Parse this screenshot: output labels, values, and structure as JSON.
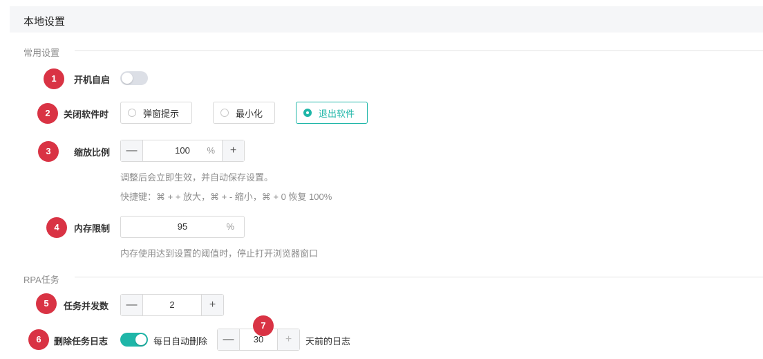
{
  "header": {
    "title": "本地设置"
  },
  "sections": {
    "common": {
      "title": "常用设置"
    },
    "rpa": {
      "title": "RPA任务"
    }
  },
  "rows": {
    "autostart": {
      "badge": "1",
      "label": "开机自启",
      "enabled": false
    },
    "close_behavior": {
      "badge": "2",
      "label": "关闭软件时",
      "options": [
        "弹窗提示",
        "最小化",
        "退出软件"
      ],
      "selected": "退出软件"
    },
    "zoom": {
      "badge": "3",
      "label": "缩放比例",
      "value": "100",
      "unit": "%",
      "minus": "—",
      "plus": "+",
      "hint1": "调整后会立即生效，并自动保存设置。",
      "hint2": "快捷键：⌘ + + 放大，⌘ + - 缩小，⌘ + 0 恢复 100%"
    },
    "memory": {
      "badge": "4",
      "label": "内存限制",
      "value": "95",
      "unit": "%",
      "hint": "内存使用达到设置的阈值时，停止打开浏览器窗口"
    },
    "concurrency": {
      "badge": "5",
      "label": "任务并发数",
      "value": "2",
      "minus": "—",
      "plus": "+"
    },
    "delete_logs": {
      "badge": "6",
      "label": "删除任务日志",
      "enabled": true,
      "prefix": "每日自动删除",
      "value_badge": "7",
      "value": "30",
      "minus": "—",
      "plus": "+",
      "suffix": "天前的日志"
    }
  },
  "colors": {
    "accent": "#1fb6a8",
    "badge": "#d93344"
  }
}
